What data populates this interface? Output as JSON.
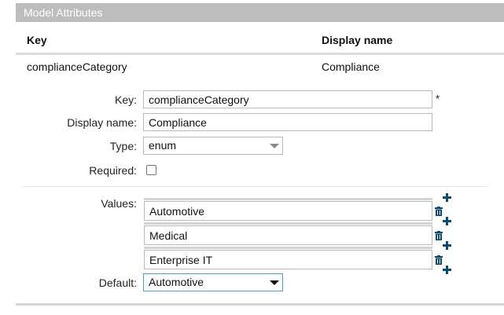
{
  "panel": {
    "title": "Model Attributes"
  },
  "table": {
    "columns": [
      "Key",
      "Display name"
    ],
    "rows": [
      {
        "key": "complianceCategory",
        "display_name": "Compliance"
      }
    ]
  },
  "form": {
    "key_label": "Key:",
    "key_value": "complianceCategory",
    "required_marker": "*",
    "display_name_label": "Display name:",
    "display_name_value": "Compliance",
    "type_label": "Type:",
    "type_value": "enum",
    "required_label": "Required:",
    "required_checked": false,
    "values_label": "Values:",
    "values": [
      "Automotive",
      "Medical",
      "Enterprise IT"
    ],
    "default_label": "Default:",
    "default_value": "Automotive"
  },
  "icons": {
    "add": "plus-icon",
    "delete": "trash-icon",
    "dropdown": "chevron-down-icon"
  },
  "colors": {
    "header_bg": "#bdbdbd",
    "icon_accent": "#0e4d69",
    "focus_border": "#4a9fd6"
  }
}
